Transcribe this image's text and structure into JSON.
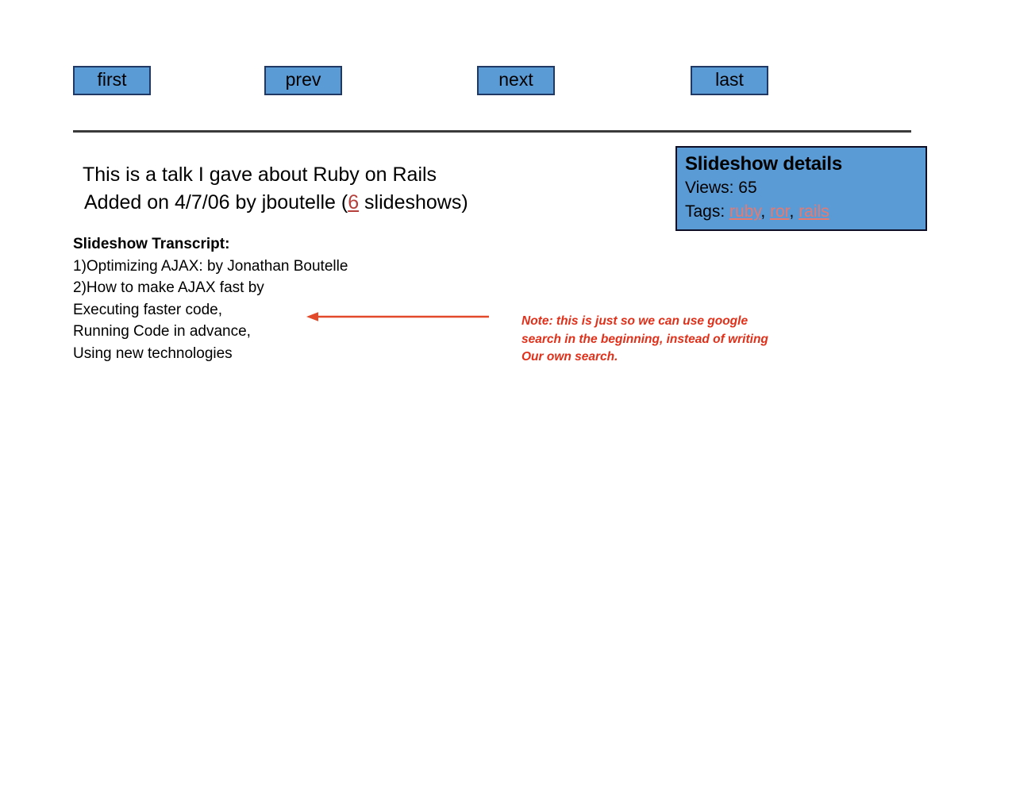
{
  "nav": {
    "buttons": [
      {
        "id": "first",
        "label": "first"
      },
      {
        "id": "prev",
        "label": "prev"
      },
      {
        "id": "next",
        "label": "next"
      },
      {
        "id": "last",
        "label": "last"
      }
    ]
  },
  "headline": {
    "line1": "This is a talk I gave about Ruby on Rails",
    "line2_before": "Added on 4/7/06 by jboutelle (",
    "line2_link": "6",
    "line2_after": " slideshows)"
  },
  "transcript": {
    "heading": "Slideshow Transcript:",
    "lines": [
      "1)Optimizing AJAX: by Jonathan Boutelle",
      "2)How to make AJAX fast by",
      "Executing faster code,",
      "Running Code in advance,",
      "Using new technologies"
    ]
  },
  "details": {
    "title": "Slideshow details",
    "views_label": "Views: 65",
    "tags_label": "Tags: ",
    "tags": [
      "ruby",
      "ror",
      "rails"
    ],
    "tag_separator": ", "
  },
  "note": {
    "line1": "Note: this is just so we can use google",
    "line2": "search in the beginning, instead of writing",
    "line3": "Our own search."
  },
  "colors": {
    "button_fill": "#5B9BD5",
    "button_border": "#1F3864",
    "panel_fill": "#5B9BD5",
    "panel_border": "#0D0D26",
    "count_link": "#B5403C",
    "tag_link": "#E8796F",
    "note_text": "#E0301A",
    "arrow": "#E24A2B",
    "divider": "#3A3A3A"
  }
}
